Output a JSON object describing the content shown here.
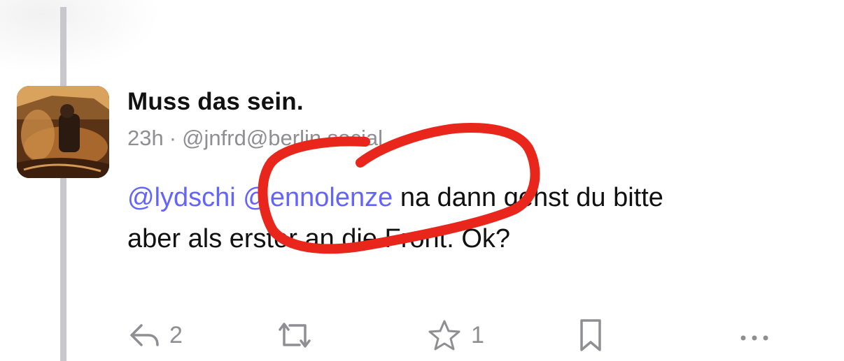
{
  "post": {
    "display_name": "Muss das sein.",
    "time": "23h",
    "separator": "·",
    "handle": "@jnfrd@berlin.social",
    "mentions": [
      "@lydschi",
      "@ennolenze"
    ],
    "text_line1_rest": " na dann gehst du bitte",
    "text_line2": "aber als erster an die Front. Ok?"
  },
  "actions": {
    "reply_icon": "reply-icon",
    "reply_count": "2",
    "boost_icon": "boost-icon",
    "favourite_icon": "star-icon",
    "favourite_count": "1",
    "bookmark_icon": "bookmark-icon",
    "more_icon": "more-icon"
  },
  "colors": {
    "mention": "#6364ff",
    "muted": "#8e8e93",
    "annotation": "#e8261b",
    "thread_line": "#c8c8cc"
  }
}
